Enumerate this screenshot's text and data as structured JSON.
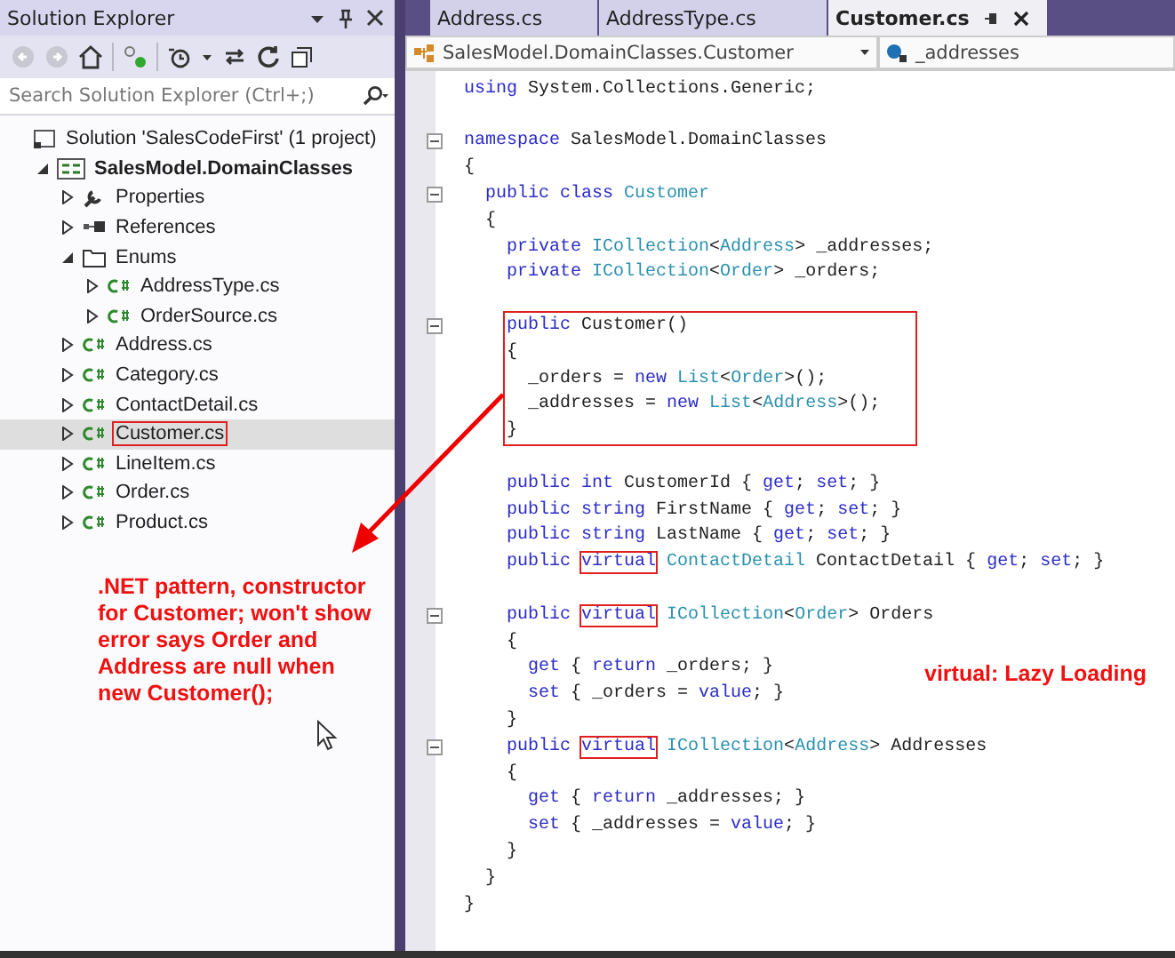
{
  "solution_explorer": {
    "title": "Solution Explorer",
    "search": {
      "placeholder": "Search Solution Explorer (Ctrl+;)"
    },
    "items": [
      {
        "label": "Solution 'SalesCodeFirst' (1 project)",
        "kind": "solution",
        "selected": false,
        "children": [
          {
            "label": "SalesModel.DomainClasses",
            "kind": "project",
            "expanded": true,
            "selected": false,
            "children": [
              {
                "label": "Properties",
                "kind": "properties",
                "expanded": false,
                "selected": false
              },
              {
                "label": "References",
                "kind": "references",
                "expanded": false,
                "selected": false
              },
              {
                "label": "Enums",
                "kind": "folder",
                "expanded": true,
                "selected": false,
                "children": [
                  {
                    "label": "AddressType.cs",
                    "kind": "csharp",
                    "expanded": false,
                    "selected": false
                  },
                  {
                    "label": "OrderSource.cs",
                    "kind": "csharp",
                    "expanded": false,
                    "selected": false
                  }
                ]
              },
              {
                "label": "Address.cs",
                "kind": "csharp",
                "expanded": false,
                "selected": false
              },
              {
                "label": "Category.cs",
                "kind": "csharp",
                "expanded": false,
                "selected": false
              },
              {
                "label": "ContactDetail.cs",
                "kind": "csharp",
                "expanded": false,
                "selected": false
              },
              {
                "label": "Customer.cs",
                "kind": "csharp",
                "expanded": false,
                "selected": true,
                "boxed": true
              },
              {
                "label": "LineItem.cs",
                "kind": "csharp",
                "expanded": false,
                "selected": false
              },
              {
                "label": "Order.cs",
                "kind": "csharp",
                "expanded": false,
                "selected": false
              },
              {
                "label": "Product.cs",
                "kind": "csharp",
                "expanded": false,
                "selected": false
              }
            ]
          }
        ]
      }
    ]
  },
  "editor": {
    "tabs": [
      {
        "label": "Address.cs",
        "selected": false
      },
      {
        "label": "AddressType.cs",
        "selected": false
      },
      {
        "label": "Customer.cs",
        "selected": true
      }
    ],
    "type_dropdown": "SalesModel.DomainClasses.Customer",
    "member_dropdown": "_addresses",
    "code": [
      {
        "kind": "line",
        "segments": [
          {
            "text": "using",
            "kind": "keyword"
          },
          {
            "text": " System.Collections.Generic;",
            "kind": "plain"
          }
        ]
      },
      {
        "kind": "blank"
      },
      {
        "kind": "line",
        "fold": true,
        "segments": [
          {
            "text": "namespace",
            "kind": "keyword"
          },
          {
            "text": " SalesModel.DomainClasses",
            "kind": "plain"
          }
        ]
      },
      {
        "kind": "line",
        "segments": [
          {
            "text": "{",
            "kind": "plain"
          }
        ]
      },
      {
        "kind": "line",
        "fold": true,
        "segments": [
          {
            "text": "  public class",
            "kind": "keyword"
          },
          {
            "text": " Customer",
            "kind": "type"
          }
        ]
      },
      {
        "kind": "line",
        "segments": [
          {
            "text": "  {",
            "kind": "plain"
          }
        ]
      },
      {
        "kind": "line",
        "segments": [
          {
            "text": "    private",
            "kind": "keyword"
          },
          {
            "text": " ICollection",
            "kind": "type"
          },
          {
            "text": "<",
            "kind": "plain"
          },
          {
            "text": "Address",
            "kind": "type"
          },
          {
            "text": "> _addresses;",
            "kind": "plain"
          }
        ]
      },
      {
        "kind": "line",
        "segments": [
          {
            "text": "    private",
            "kind": "keyword"
          },
          {
            "text": " ICollection",
            "kind": "type"
          },
          {
            "text": "<",
            "kind": "plain"
          },
          {
            "text": "Order",
            "kind": "type"
          },
          {
            "text": "> _orders;",
            "kind": "plain"
          }
        ]
      },
      {
        "kind": "blank"
      },
      {
        "kind": "highlight",
        "lines": [
          {
            "kind": "line",
            "fold": true,
            "segments": [
              {
                "text": "    public",
                "kind": "keyword"
              },
              {
                "text": " Customer()",
                "kind": "plain"
              }
            ]
          },
          {
            "kind": "line",
            "segments": [
              {
                "text": "    {",
                "kind": "plain"
              }
            ]
          },
          {
            "kind": "line",
            "segments": [
              {
                "text": "      _orders = ",
                "kind": "plain"
              },
              {
                "text": "new",
                "kind": "keyword"
              },
              {
                "text": " List",
                "kind": "type"
              },
              {
                "text": "<",
                "kind": "plain"
              },
              {
                "text": "Order",
                "kind": "type"
              },
              {
                "text": ">();",
                "kind": "plain"
              }
            ]
          },
          {
            "kind": "line",
            "segments": [
              {
                "text": "      _addresses = ",
                "kind": "plain"
              },
              {
                "text": "new",
                "kind": "keyword"
              },
              {
                "text": " List",
                "kind": "type"
              },
              {
                "text": "<",
                "kind": "plain"
              },
              {
                "text": "Address",
                "kind": "type"
              },
              {
                "text": ">();",
                "kind": "plain"
              }
            ]
          },
          {
            "kind": "line",
            "segments": [
              {
                "text": "    }",
                "kind": "plain"
              }
            ]
          }
        ]
      },
      {
        "kind": "blank"
      },
      {
        "kind": "line",
        "segments": [
          {
            "text": "    public int",
            "kind": "keyword"
          },
          {
            "text": " CustomerId { ",
            "kind": "plain"
          },
          {
            "text": "get",
            "kind": "keyword"
          },
          {
            "text": "; ",
            "kind": "plain"
          },
          {
            "text": "set",
            "kind": "keyword"
          },
          {
            "text": "; }",
            "kind": "plain"
          }
        ]
      },
      {
        "kind": "line",
        "segments": [
          {
            "text": "    public string",
            "kind": "keyword"
          },
          {
            "text": " FirstName { ",
            "kind": "plain"
          },
          {
            "text": "get",
            "kind": "keyword"
          },
          {
            "text": "; ",
            "kind": "plain"
          },
          {
            "text": "set",
            "kind": "keyword"
          },
          {
            "text": "; }",
            "kind": "plain"
          }
        ]
      },
      {
        "kind": "line",
        "segments": [
          {
            "text": "    public string",
            "kind": "keyword"
          },
          {
            "text": " LastName { ",
            "kind": "plain"
          },
          {
            "text": "get",
            "kind": "keyword"
          },
          {
            "text": "; ",
            "kind": "plain"
          },
          {
            "text": "set",
            "kind": "keyword"
          },
          {
            "text": "; }",
            "kind": "plain"
          }
        ]
      },
      {
        "kind": "line",
        "segments": [
          {
            "text": "    public ",
            "kind": "keyword"
          },
          {
            "text": "virtual",
            "kind": "keyword",
            "boxed": true
          },
          {
            "text": " ContactDetail",
            "kind": "type"
          },
          {
            "text": " ContactDetail { ",
            "kind": "plain"
          },
          {
            "text": "get",
            "kind": "keyword"
          },
          {
            "text": "; ",
            "kind": "plain"
          },
          {
            "text": "set",
            "kind": "keyword"
          },
          {
            "text": "; }",
            "kind": "plain"
          }
        ]
      },
      {
        "kind": "blank"
      },
      {
        "kind": "line",
        "fold": true,
        "segments": [
          {
            "text": "    public ",
            "kind": "keyword"
          },
          {
            "text": "virtual",
            "kind": "keyword",
            "boxed": true
          },
          {
            "text": " ICollection",
            "kind": "type"
          },
          {
            "text": "<",
            "kind": "plain"
          },
          {
            "text": "Order",
            "kind": "type"
          },
          {
            "text": "> Orders",
            "kind": "plain"
          }
        ]
      },
      {
        "kind": "line",
        "segments": [
          {
            "text": "    {",
            "kind": "plain"
          }
        ]
      },
      {
        "kind": "line",
        "segments": [
          {
            "text": "      get",
            "kind": "keyword"
          },
          {
            "text": " { ",
            "kind": "plain"
          },
          {
            "text": "return",
            "kind": "keyword"
          },
          {
            "text": " _orders; }",
            "kind": "plain"
          }
        ]
      },
      {
        "kind": "line",
        "segments": [
          {
            "text": "      set",
            "kind": "keyword"
          },
          {
            "text": " { _orders = ",
            "kind": "plain"
          },
          {
            "text": "value",
            "kind": "keyword"
          },
          {
            "text": "; }",
            "kind": "plain"
          }
        ]
      },
      {
        "kind": "line",
        "segments": [
          {
            "text": "    }",
            "kind": "plain"
          }
        ]
      },
      {
        "kind": "line",
        "fold": true,
        "segments": [
          {
            "text": "    public ",
            "kind": "keyword"
          },
          {
            "text": "virtual",
            "kind": "keyword",
            "boxed": true
          },
          {
            "text": " ICollection",
            "kind": "type"
          },
          {
            "text": "<",
            "kind": "plain"
          },
          {
            "text": "Address",
            "kind": "type"
          },
          {
            "text": "> Addresses",
            "kind": "plain"
          }
        ]
      },
      {
        "kind": "line",
        "segments": [
          {
            "text": "    {",
            "kind": "plain"
          }
        ]
      },
      {
        "kind": "line",
        "segments": [
          {
            "text": "      get",
            "kind": "keyword"
          },
          {
            "text": " { ",
            "kind": "plain"
          },
          {
            "text": "return",
            "kind": "keyword"
          },
          {
            "text": " _addresses; }",
            "kind": "plain"
          }
        ]
      },
      {
        "kind": "line",
        "segments": [
          {
            "text": "      set",
            "kind": "keyword"
          },
          {
            "text": " { _addresses = ",
            "kind": "plain"
          },
          {
            "text": "value",
            "kind": "keyword"
          },
          {
            "text": "; }",
            "kind": "plain"
          }
        ]
      },
      {
        "kind": "line",
        "segments": [
          {
            "text": "    }",
            "kind": "plain"
          }
        ]
      },
      {
        "kind": "line",
        "segments": [
          {
            "text": "  }",
            "kind": "plain"
          }
        ]
      },
      {
        "kind": "line",
        "segments": [
          {
            "text": "}",
            "kind": "plain"
          }
        ]
      }
    ]
  },
  "annotations": [
    {
      "text": ".NET pattern, constructor for Customer; won't show error says Order and Address are null when new Customer();",
      "kind": "left"
    },
    {
      "text": "virtual: Lazy Loading",
      "kind": "right"
    }
  ]
}
